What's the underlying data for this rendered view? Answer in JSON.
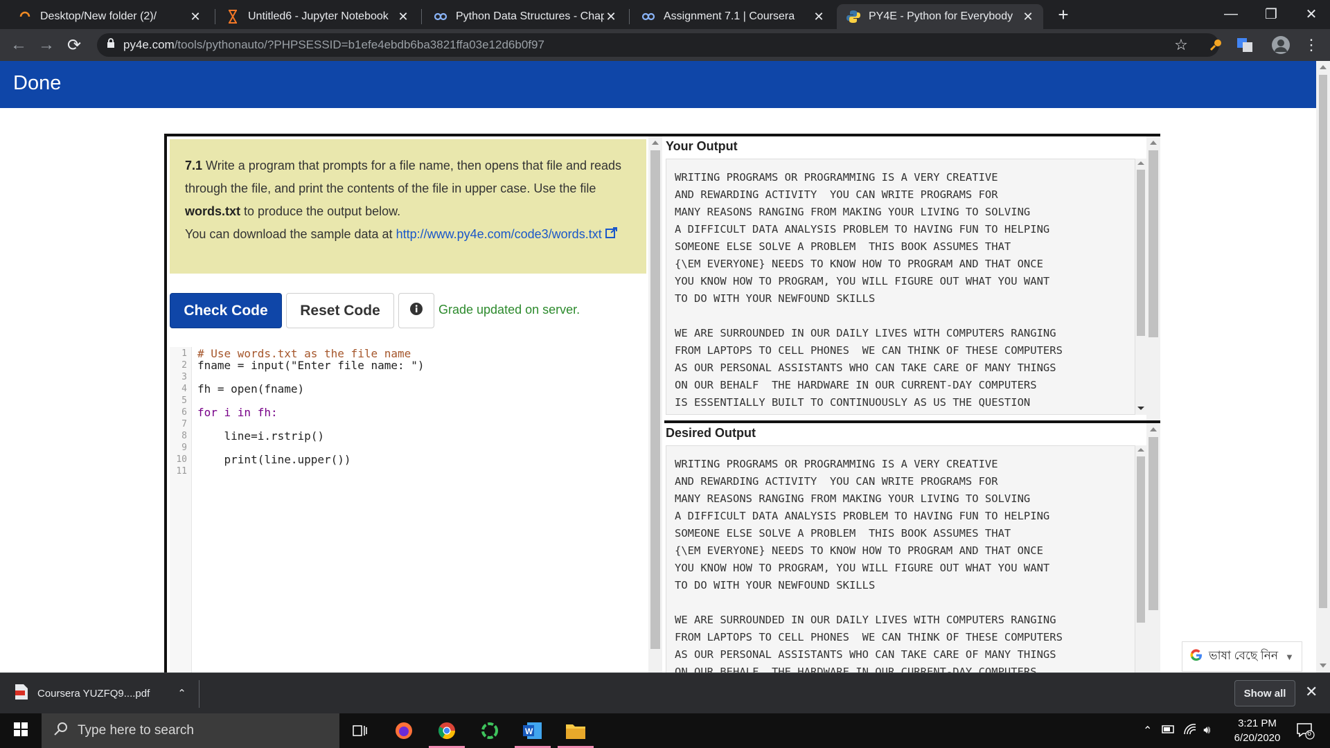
{
  "browser": {
    "tabs": [
      {
        "title": "Desktop/New folder (2)/",
        "icon": "loading-spinner-icon"
      },
      {
        "title": "Untitled6 - Jupyter Notebook",
        "icon": "hourglass-icon"
      },
      {
        "title": "Python Data Structures - Chapter",
        "icon": "coursera-icon"
      },
      {
        "title": "Assignment 7.1 | Coursera",
        "icon": "coursera-icon"
      },
      {
        "title": "PY4E - Python for Everybody",
        "icon": "python-icon",
        "active": true
      }
    ],
    "url_host": "py4e.com",
    "url_path": "/tools/pythonauto/?PHPSESSID=b1efe4ebdb6ba3821ffa03e12d6b0f97"
  },
  "page": {
    "banner_title": "Done",
    "prompt": {
      "number": "7.1",
      "text1": " Write a program that prompts for a file name, then opens that file and reads through the file, and print the contents of the file in upper case. Use the file ",
      "file": "words.txt",
      "text2": " to produce the output below.",
      "download_text": "You can download the sample data at ",
      "download_link": "http://www.py4e.com/code3/words.txt"
    },
    "buttons": {
      "check": "Check Code",
      "reset": "Reset Code"
    },
    "grade_status": "Grade updated on server.",
    "code_lines": [
      {
        "n": "1",
        "text": "# Use words.txt as the file name"
      },
      {
        "n": "2",
        "text": "fname = input(\"Enter file name: \")"
      },
      {
        "n": "3",
        "text": ""
      },
      {
        "n": "4",
        "text": "fh = open(fname)"
      },
      {
        "n": "5",
        "text": ""
      },
      {
        "n": "6",
        "text": "for i in fh:"
      },
      {
        "n": "7",
        "text": ""
      },
      {
        "n": "8",
        "text": "    line=i.rstrip()"
      },
      {
        "n": "9",
        "text": ""
      },
      {
        "n": "10",
        "text": "    print(line.upper())"
      },
      {
        "n": "11",
        "text": ""
      }
    ],
    "your_output": {
      "title": "Your Output",
      "text": "WRITING PROGRAMS OR PROGRAMMING IS A VERY CREATIVE\nAND REWARDING ACTIVITY  YOU CAN WRITE PROGRAMS FOR\nMANY REASONS RANGING FROM MAKING YOUR LIVING TO SOLVING\nA DIFFICULT DATA ANALYSIS PROBLEM TO HAVING FUN TO HELPING\nSOMEONE ELSE SOLVE A PROBLEM  THIS BOOK ASSUMES THAT\n{\\EM EVERYONE} NEEDS TO KNOW HOW TO PROGRAM AND THAT ONCE\nYOU KNOW HOW TO PROGRAM, YOU WILL FIGURE OUT WHAT YOU WANT\nTO DO WITH YOUR NEWFOUND SKILLS\n\nWE ARE SURROUNDED IN OUR DAILY LIVES WITH COMPUTERS RANGING\nFROM LAPTOPS TO CELL PHONES  WE CAN THINK OF THESE COMPUTERS\nAS OUR PERSONAL ASSISTANTS WHO CAN TAKE CARE OF MANY THINGS\nON OUR BEHALF  THE HARDWARE IN OUR CURRENT-DAY COMPUTERS\nIS ESSENTIALLY BUILT TO CONTINUOUSLY AS US THE QUESTION\nWHAT WOULD YOU LIKE ME TO DO NEXT"
    },
    "desired_output": {
      "title": "Desired Output",
      "text": "WRITING PROGRAMS OR PROGRAMMING IS A VERY CREATIVE\nAND REWARDING ACTIVITY  YOU CAN WRITE PROGRAMS FOR\nMANY REASONS RANGING FROM MAKING YOUR LIVING TO SOLVING\nA DIFFICULT DATA ANALYSIS PROBLEM TO HAVING FUN TO HELPING\nSOMEONE ELSE SOLVE A PROBLEM  THIS BOOK ASSUMES THAT\n{\\EM EVERYONE} NEEDS TO KNOW HOW TO PROGRAM AND THAT ONCE\nYOU KNOW HOW TO PROGRAM, YOU WILL FIGURE OUT WHAT YOU WANT\nTO DO WITH YOUR NEWFOUND SKILLS\n\nWE ARE SURROUNDED IN OUR DAILY LIVES WITH COMPUTERS RANGING\nFROM LAPTOPS TO CELL PHONES  WE CAN THINK OF THESE COMPUTERS\nAS OUR PERSONAL ASSISTANTS WHO CAN TAKE CARE OF MANY THINGS\nON OUR BEHALF  THE HARDWARE IN OUR CURRENT-DAY COMPUTERS"
    },
    "translate_label": "ভাষা বেছে নিন"
  },
  "downloads": {
    "file": "Coursera YUZFQ9....pdf",
    "show_all": "Show all"
  },
  "taskbar": {
    "search_placeholder": "Type here to search",
    "time": "3:21 PM",
    "date": "6/20/2020",
    "notification_count": "6"
  },
  "colors": {
    "banner": "#0f46a8",
    "prompt_bg": "#e9e7ad",
    "grade_green": "#2c8a2c",
    "link_blue": "#1a57c9"
  }
}
